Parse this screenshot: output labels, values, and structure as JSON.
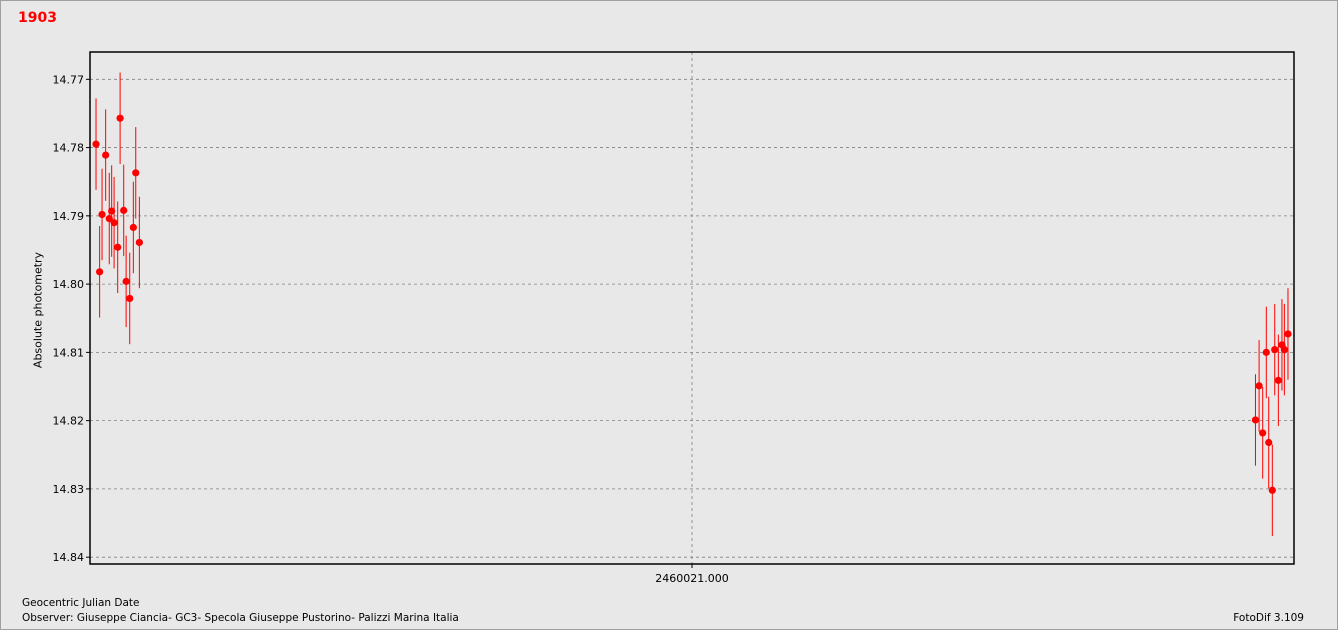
{
  "header": {
    "title": "1903"
  },
  "footer": {
    "xlabel": "Geocentric Julian Date",
    "observer": "Observer: Giuseppe Ciancia- GC3- Specola Giuseppe Pustorino- Palizzi Marina Italia",
    "software": "FotoDif 3.109"
  },
  "colors": {
    "accent": "#ff0000",
    "grid": "#808080",
    "background": "#e8e8e8"
  },
  "chart_data": {
    "type": "scatter",
    "title": "1903",
    "xlabel": "Geocentric Julian Date",
    "ylabel": "Absolute photometry",
    "y_inverted": true,
    "ylim": [
      14.766,
      14.841
    ],
    "y_ticks": [
      "14.77",
      "14.78",
      "14.79",
      "14.80",
      "14.81",
      "14.82",
      "14.83",
      "14.84"
    ],
    "x_ticks": [
      "2460021.000"
    ],
    "grid": true,
    "legend": "none",
    "series": [
      {
        "marker": "filled-circle-with-error-bars",
        "color": "#ff0000",
        "points": [
          {
            "x": 0.005,
            "y": 14.7795,
            "err": 0.0067
          },
          {
            "x": 0.008,
            "y": 14.7982,
            "err": 0.0067
          },
          {
            "x": 0.01,
            "y": 14.7898,
            "err": 0.0067
          },
          {
            "x": 0.013,
            "y": 14.7811,
            "err": 0.0067
          },
          {
            "x": 0.016,
            "y": 14.7904,
            "err": 0.0067
          },
          {
            "x": 0.018,
            "y": 14.7893,
            "err": 0.0067
          },
          {
            "x": 0.02,
            "y": 14.791,
            "err": 0.0067
          },
          {
            "x": 0.023,
            "y": 14.7946,
            "err": 0.0067
          },
          {
            "x": 0.025,
            "y": 14.7757,
            "err": 0.0067
          },
          {
            "x": 0.028,
            "y": 14.7892,
            "err": 0.0067
          },
          {
            "x": 0.03,
            "y": 14.7996,
            "err": 0.0067
          },
          {
            "x": 0.033,
            "y": 14.8021,
            "err": 0.0067
          },
          {
            "x": 0.036,
            "y": 14.7917,
            "err": 0.0067
          },
          {
            "x": 0.038,
            "y": 14.7837,
            "err": 0.0067
          },
          {
            "x": 0.041,
            "y": 14.7939,
            "err": 0.0067
          },
          {
            "x": 0.968,
            "y": 14.8199,
            "err": 0.0067
          },
          {
            "x": 0.971,
            "y": 14.8149,
            "err": 0.0067
          },
          {
            "x": 0.974,
            "y": 14.8218,
            "err": 0.0067
          },
          {
            "x": 0.977,
            "y": 14.81,
            "err": 0.0067
          },
          {
            "x": 0.979,
            "y": 14.8232,
            "err": 0.0067
          },
          {
            "x": 0.982,
            "y": 14.8302,
            "err": 0.0067
          },
          {
            "x": 0.984,
            "y": 14.8096,
            "err": 0.0067
          },
          {
            "x": 0.987,
            "y": 14.8141,
            "err": 0.0067
          },
          {
            "x": 0.99,
            "y": 14.8089,
            "err": 0.0067
          },
          {
            "x": 0.992,
            "y": 14.8096,
            "err": 0.0067
          },
          {
            "x": 0.995,
            "y": 14.8073,
            "err": 0.0067
          }
        ]
      }
    ]
  }
}
